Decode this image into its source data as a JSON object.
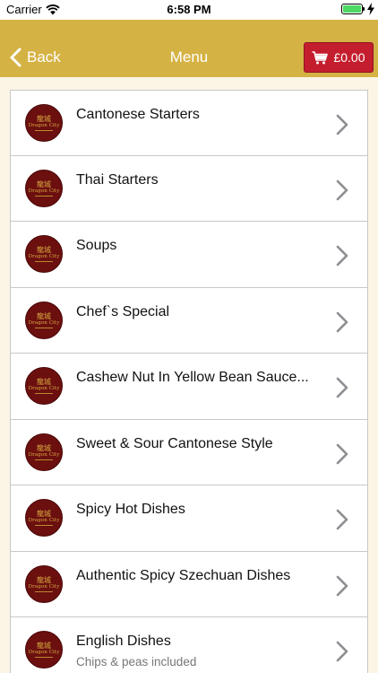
{
  "status_bar": {
    "carrier": "Carrier",
    "time": "6:58 PM",
    "icons": [
      "wifi-icon",
      "battery-icon",
      "charging-icon"
    ]
  },
  "navbar": {
    "back_label": "Back",
    "title": "Menu",
    "cart_total": "£0.00",
    "colors": {
      "bar": "#d5b244",
      "cart": "#c41e2e"
    }
  },
  "logo": {
    "glyph": "龍城",
    "name": "Dragon City"
  },
  "menu": {
    "items": [
      {
        "title": "Cantonese Starters",
        "subtitle": ""
      },
      {
        "title": "Thai Starters",
        "subtitle": ""
      },
      {
        "title": "Soups",
        "subtitle": ""
      },
      {
        "title": "Chef`s Special",
        "subtitle": ""
      },
      {
        "title": "Cashew Nut In Yellow Bean Sauce...",
        "subtitle": ""
      },
      {
        "title": "Sweet & Sour Cantonese Style",
        "subtitle": ""
      },
      {
        "title": "Spicy Hot Dishes",
        "subtitle": ""
      },
      {
        "title": "Authentic Spicy Szechuan Dishes",
        "subtitle": ""
      },
      {
        "title": "English Dishes",
        "subtitle": "Chips & peas included"
      }
    ]
  }
}
